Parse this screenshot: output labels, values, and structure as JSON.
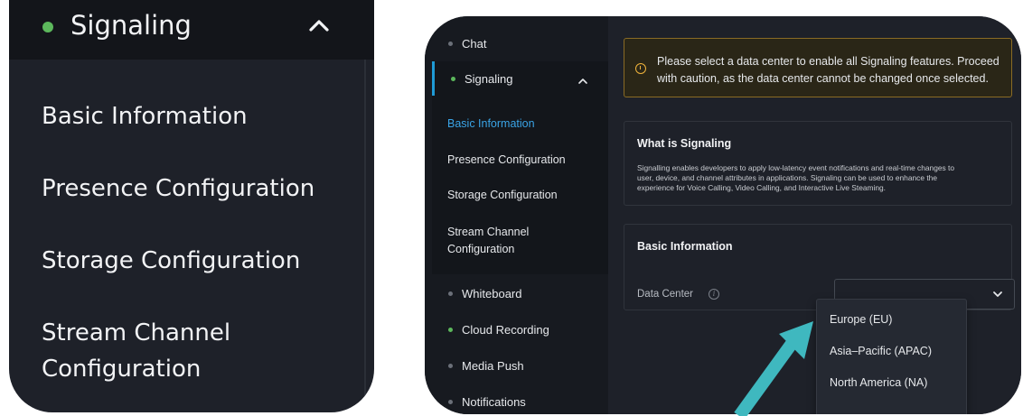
{
  "zoom": {
    "section_title": "Signaling",
    "items": [
      "Basic Information",
      "Presence Configuration",
      "Storage Configuration",
      "Stream Channel",
      "Configuration"
    ]
  },
  "sidebar": {
    "top_item": "Chat",
    "active_section": "Signaling",
    "sub_items": [
      "Basic Information",
      "Presence Configuration",
      "Storage Configuration",
      "Stream Channel",
      "Configuration"
    ],
    "other_items": [
      "Whiteboard",
      "Cloud Recording",
      "Media Push",
      "Notifications"
    ]
  },
  "notice": {
    "line1": "Please select a data center to enable all Signaling features. Proceed",
    "line2": "with caution, as the data center cannot be changed once selected."
  },
  "what_is": {
    "title": "What is Signaling",
    "line1": "Signalling enables developers to apply low-latency event notifications and real-time changes to",
    "line2": "user, device, and channel attributes in applications. Signaling can be used to enhance the",
    "line3": "experience for Voice Calling, Video Calling, and Interactive Live Steaming."
  },
  "basic_info": {
    "title": "Basic Information",
    "data_center_label": "Data Center",
    "info_glyph": "i"
  },
  "dropdown": {
    "options": [
      "Europe (EU)",
      "Asia–Pacific (APAC)",
      "North America (NA)"
    ]
  },
  "colors": {
    "accent_arrow": "#3fb8bf",
    "active_link": "#3aa4e6",
    "status_dot": "#5cb85c",
    "warning": "#f0b33b"
  }
}
